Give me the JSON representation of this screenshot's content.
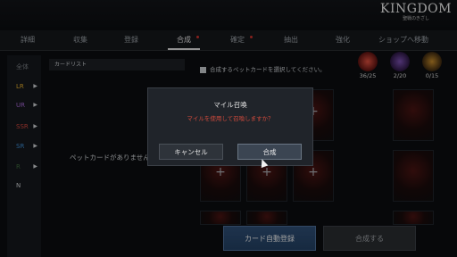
{
  "logo": {
    "title": "KINGDOM",
    "subtitle": "聖戦のきざし"
  },
  "tabs": [
    {
      "label": "詳細",
      "active": false,
      "alert": false
    },
    {
      "label": "収集",
      "active": false,
      "alert": false
    },
    {
      "label": "登録",
      "active": false,
      "alert": false
    },
    {
      "label": "合成",
      "active": true,
      "alert": true
    },
    {
      "label": "確定",
      "active": false,
      "alert": true
    },
    {
      "label": "抽出",
      "active": false,
      "alert": false
    },
    {
      "label": "強化",
      "active": false,
      "alert": false
    },
    {
      "label": "ショップへ移動",
      "active": false,
      "alert": false
    }
  ],
  "rarity_filters": [
    {
      "label": "全体",
      "color": "#7a7f85"
    },
    {
      "label": "LR",
      "color": "#e9b02e"
    },
    {
      "label": "UR",
      "color": "#a96ad8"
    },
    {
      "label": "SSR",
      "color": "#d0473e"
    },
    {
      "label": "SR",
      "color": "#3f8fd6"
    },
    {
      "label": "R",
      "color": "#3e6b3e"
    },
    {
      "label": "N",
      "color": "#cfd3d6"
    }
  ],
  "card_list": {
    "header": "カードリスト",
    "empty_text": "ペットカードがありません"
  },
  "hint": "合成するペットカードを選択してください。",
  "resources": [
    {
      "value": "36/25",
      "color": "#d0473e",
      "glow": "#e0503f"
    },
    {
      "value": "2/20",
      "color": "#a96ad8",
      "glow": "#7a4fb0"
    },
    {
      "value": "0/15",
      "color": "#e9b02e",
      "glow": "#c48a2a"
    }
  ],
  "dialog": {
    "title": "マイル召喚",
    "message": "マイルを使用して召喚しますか？",
    "cancel_label": "キャンセル",
    "confirm_label": "合成"
  },
  "bottom": {
    "auto_register_label": "カード自動登録",
    "synthesize_label": "合成する"
  },
  "colors": {
    "accent_blue": "#2f4f76",
    "warning_red": "#d04a3c"
  }
}
